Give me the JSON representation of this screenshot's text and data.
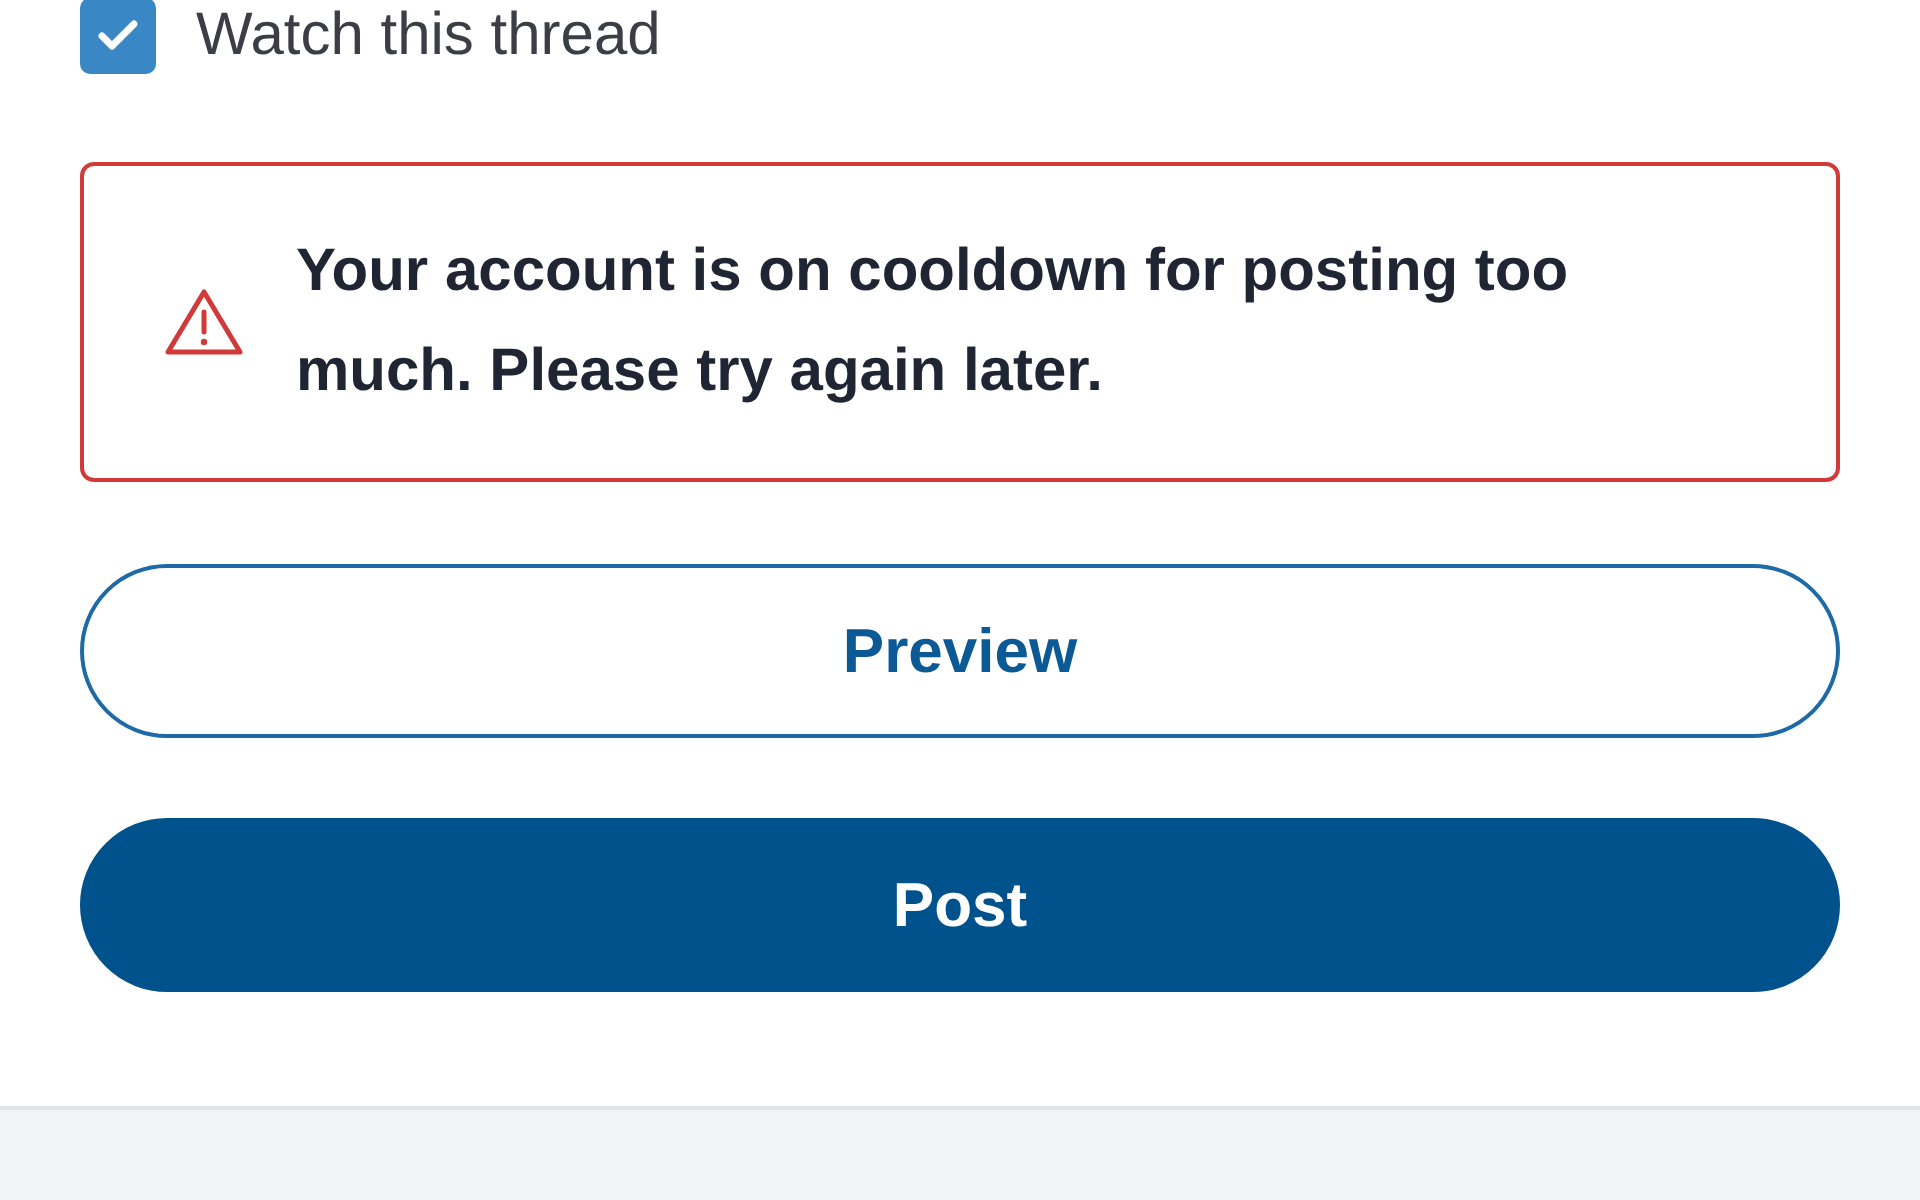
{
  "watch": {
    "label": "Watch this thread",
    "checked": true
  },
  "error": {
    "message": "Your account is on cooldown for posting too much. Please try again later."
  },
  "buttons": [
    {
      "label": "Preview",
      "kind": "outline"
    },
    {
      "label": "Post",
      "kind": "primary"
    }
  ]
}
